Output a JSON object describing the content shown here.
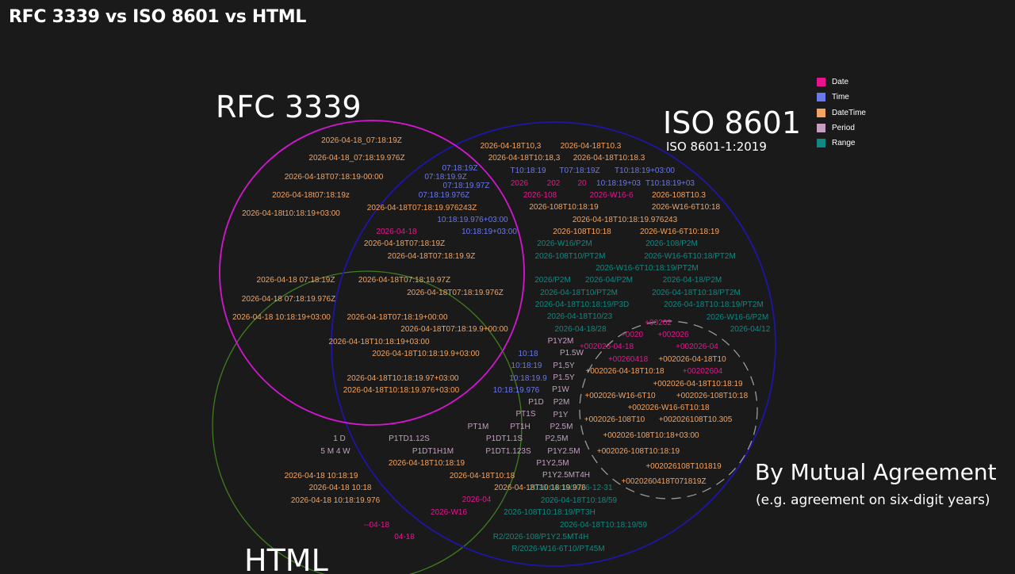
{
  "title": "RFC 3339 vs ISO 8601 vs HTML",
  "colors": {
    "background": "#1a1a1a",
    "Date": "#e6158f",
    "Time": "#6a78ee",
    "DateTime": "#f4a460",
    "Period": "#c49fc0",
    "Range": "#0e8a82",
    "rfc_circle": "#d416d2",
    "iso_circle": "#1f15a8",
    "html_circle": "#3f7d1e",
    "mutual_circle": "#9a9a9a"
  },
  "legend": [
    {
      "label": "Date",
      "key": "Date"
    },
    {
      "label": "Time",
      "key": "Time"
    },
    {
      "label": "DateTime",
      "key": "DateTime"
    },
    {
      "label": "Period",
      "key": "Period"
    },
    {
      "label": "Range",
      "key": "Range"
    }
  ],
  "sets": {
    "rfc": {
      "name": "RFC 3339"
    },
    "iso": {
      "name": "ISO 8601",
      "subtitle": "ISO 8601-1:2019"
    },
    "html": {
      "name": "HTML"
    },
    "mutual": {
      "name": "By Mutual Agreement",
      "subtitle": "(e.g. agreement on six-digit years)"
    }
  },
  "items": [
    {
      "text": "2026-04-18_07:18:19Z",
      "type": "DateTime",
      "region": "rfc"
    },
    {
      "text": "2026-04-18_07:18:19.976Z",
      "type": "DateTime",
      "region": "rfc"
    },
    {
      "text": "2026-04-18T07:18:19-00:00",
      "type": "DateTime",
      "region": "rfc"
    },
    {
      "text": "2026-04-18t07:18:19z",
      "type": "DateTime",
      "region": "rfc"
    },
    {
      "text": "2026-04-18t10:18:19+03:00",
      "type": "DateTime",
      "region": "rfc"
    },
    {
      "text": "07:18:19Z",
      "type": "Time",
      "region": "rfc+iso"
    },
    {
      "text": "07:18:19.9Z",
      "type": "Time",
      "region": "rfc+iso"
    },
    {
      "text": "07:18:19.97Z",
      "type": "Time",
      "region": "rfc+iso"
    },
    {
      "text": "07:18:19.976Z",
      "type": "Time",
      "region": "rfc+iso"
    },
    {
      "text": "2026-04-18T07:18:19.976243Z",
      "type": "DateTime",
      "region": "rfc+iso"
    },
    {
      "text": "10:18:19.976+03:00",
      "type": "Time",
      "region": "rfc+iso"
    },
    {
      "text": "10:18:19+03:00",
      "type": "Time",
      "region": "rfc+iso"
    },
    {
      "text": "2026-04-18",
      "type": "Date",
      "region": "all"
    },
    {
      "text": "2026-04-18T07:18:19Z",
      "type": "DateTime",
      "region": "all"
    },
    {
      "text": "2026-04-18T07:18:19.9Z",
      "type": "DateTime",
      "region": "all"
    },
    {
      "text": "2026-04-18T07:18:19.97Z",
      "type": "DateTime",
      "region": "all"
    },
    {
      "text": "2026-04-18T07:18:19.976Z",
      "type": "DateTime",
      "region": "all"
    },
    {
      "text": "2026-04-18T07:18:19+00:00",
      "type": "DateTime",
      "region": "all"
    },
    {
      "text": "2026-04-18T07:18:19.9+00:00",
      "type": "DateTime",
      "region": "all"
    },
    {
      "text": "2026-04-18T10:18:19+03:00",
      "type": "DateTime",
      "region": "all"
    },
    {
      "text": "2026-04-18T10:18:19.9+03:00",
      "type": "DateTime",
      "region": "all"
    },
    {
      "text": "2026-04-18T10:18:19.97+03:00",
      "type": "DateTime",
      "region": "all"
    },
    {
      "text": "2026-04-18T10:18:19.976+03:00",
      "type": "DateTime",
      "region": "all"
    },
    {
      "text": "2026-04-18 07:18:19Z",
      "type": "DateTime",
      "region": "rfc+html"
    },
    {
      "text": "2026-04-18 07:18:19.976Z",
      "type": "DateTime",
      "region": "rfc+html"
    },
    {
      "text": "2026-04-18 10:18:19+03:00",
      "type": "DateTime",
      "region": "rfc+html"
    },
    {
      "text": "2026-04-18T10,3",
      "type": "DateTime",
      "region": "iso"
    },
    {
      "text": "2026-04-18T10.3",
      "type": "DateTime",
      "region": "iso"
    },
    {
      "text": "2026-04-18T10:18,3",
      "type": "DateTime",
      "region": "iso"
    },
    {
      "text": "2026-04-18T10:18.3",
      "type": "DateTime",
      "region": "iso"
    },
    {
      "text": "T10:18:19",
      "type": "Time",
      "region": "iso"
    },
    {
      "text": "T07:18:19Z",
      "type": "Time",
      "region": "iso"
    },
    {
      "text": "T10:18:19+03:00",
      "type": "Time",
      "region": "iso"
    },
    {
      "text": "2026",
      "type": "Date",
      "region": "iso"
    },
    {
      "text": "202",
      "type": "Date",
      "region": "iso"
    },
    {
      "text": "20",
      "type": "Date",
      "region": "iso"
    },
    {
      "text": "10:18:19+03",
      "type": "Time",
      "region": "iso"
    },
    {
      "text": "T10:18:19+03",
      "type": "Time",
      "region": "iso"
    },
    {
      "text": "2026-108",
      "type": "Date",
      "region": "iso"
    },
    {
      "text": "2026-W16-6",
      "type": "Date",
      "region": "iso"
    },
    {
      "text": "2026-108T10.3",
      "type": "DateTime",
      "region": "iso"
    },
    {
      "text": "2026-108T10:18:19",
      "type": "DateTime",
      "region": "iso"
    },
    {
      "text": "2026-W16-6T10:18",
      "type": "DateTime",
      "region": "iso"
    },
    {
      "text": "2026-04-18T10:18:19.976243",
      "type": "DateTime",
      "region": "iso"
    },
    {
      "text": "2026-108T10:18",
      "type": "DateTime",
      "region": "iso"
    },
    {
      "text": "2026-W16-6T10:18:19",
      "type": "DateTime",
      "region": "iso"
    },
    {
      "text": "2026-W16/P2M",
      "type": "Range",
      "region": "iso"
    },
    {
      "text": "2026-108/P2M",
      "type": "Range",
      "region": "iso"
    },
    {
      "text": "2026-108T10/PT2M",
      "type": "Range",
      "region": "iso"
    },
    {
      "text": "2026-W16-6T10:18/PT2M",
      "type": "Range",
      "region": "iso"
    },
    {
      "text": "2026-W16-6T10:18:19/PT2M",
      "type": "Range",
      "region": "iso"
    },
    {
      "text": "2026/P2M",
      "type": "Range",
      "region": "iso"
    },
    {
      "text": "2026-04/P2M",
      "type": "Range",
      "region": "iso"
    },
    {
      "text": "2026-04-18/P2M",
      "type": "Range",
      "region": "iso"
    },
    {
      "text": "2026-04-18T10/PT2M",
      "type": "Range",
      "region": "iso"
    },
    {
      "text": "2026-04-18T10:18/PT2M",
      "type": "Range",
      "region": "iso"
    },
    {
      "text": "2026-04-18T10:18:19/P3D",
      "type": "Range",
      "region": "iso"
    },
    {
      "text": "2026-04-18T10:18:19/PT2M",
      "type": "Range",
      "region": "iso"
    },
    {
      "text": "2026-04-18T10/23",
      "type": "Range",
      "region": "iso"
    },
    {
      "text": "2026-W16-6/P2M",
      "type": "Range",
      "region": "iso"
    },
    {
      "text": "2026-04-18/28",
      "type": "Range",
      "region": "iso"
    },
    {
      "text": "2026-04/12",
      "type": "Range",
      "region": "iso"
    },
    {
      "text": "P1Y2M",
      "type": "Period",
      "region": "iso"
    },
    {
      "text": "P1.5W",
      "type": "Period",
      "region": "iso"
    },
    {
      "text": "P1,5Y",
      "type": "Period",
      "region": "iso"
    },
    {
      "text": "P1.5Y",
      "type": "Period",
      "region": "iso"
    },
    {
      "text": "P1W",
      "type": "Period",
      "region": "iso"
    },
    {
      "text": "P2M",
      "type": "Period",
      "region": "iso"
    },
    {
      "text": "P1Y",
      "type": "Period",
      "region": "iso"
    },
    {
      "text": "P2.5M",
      "type": "Period",
      "region": "iso"
    },
    {
      "text": "P2,5M",
      "type": "Period",
      "region": "iso"
    },
    {
      "text": "P1Y2.5M",
      "type": "Period",
      "region": "iso"
    },
    {
      "text": "P1Y2,5M",
      "type": "Period",
      "region": "iso"
    },
    {
      "text": "P1Y2.5MT4H",
      "type": "Period",
      "region": "iso"
    },
    {
      "text": "2026-04-18/2026-12-31",
      "type": "Range",
      "region": "iso"
    },
    {
      "text": "2026-04-18T10:18/59",
      "type": "Range",
      "region": "iso"
    },
    {
      "text": "2026-108T10:18:19/PT3H",
      "type": "Range",
      "region": "iso"
    },
    {
      "text": "2026-04-18T10:18:19/59",
      "type": "Range",
      "region": "iso"
    },
    {
      "text": "R2/2026-108/P1Y2.5MT4H",
      "type": "Range",
      "region": "iso"
    },
    {
      "text": "R/2026-W16-6T10/PT45M",
      "type": "Range",
      "region": "iso"
    },
    {
      "text": "10:18",
      "type": "Time",
      "region": "iso+html"
    },
    {
      "text": "10:18:19",
      "type": "Time",
      "region": "iso+html"
    },
    {
      "text": "10:18:19.9",
      "type": "Time",
      "region": "iso+html"
    },
    {
      "text": "10:18:19.976",
      "type": "Time",
      "region": "iso+html"
    },
    {
      "text": "P1D",
      "type": "Period",
      "region": "iso+html"
    },
    {
      "text": "PT1S",
      "type": "Period",
      "region": "iso+html"
    },
    {
      "text": "PT1M",
      "type": "Period",
      "region": "iso+html"
    },
    {
      "text": "PT1H",
      "type": "Period",
      "region": "iso+html"
    },
    {
      "text": "P1TD1.12S",
      "type": "Period",
      "region": "iso+html"
    },
    {
      "text": "P1DT1.1S",
      "type": "Period",
      "region": "iso+html"
    },
    {
      "text": "P1DT1H1M",
      "type": "Period",
      "region": "iso+html"
    },
    {
      "text": "P1DT1.123S",
      "type": "Period",
      "region": "iso+html"
    },
    {
      "text": "2026-04-18T10:18:19",
      "type": "DateTime",
      "region": "iso+html"
    },
    {
      "text": "2026-04-18T10:18",
      "type": "DateTime",
      "region": "iso+html"
    },
    {
      "text": "2026-04-18T10:18:19.976",
      "type": "DateTime",
      "region": "iso+html"
    },
    {
      "text": "2026-04",
      "type": "Date",
      "region": "iso+html"
    },
    {
      "text": "2026-W16",
      "type": "Date",
      "region": "iso+html"
    },
    {
      "text": "1 D",
      "type": "Period",
      "region": "html"
    },
    {
      "text": "5 M 4 W",
      "type": "Period",
      "region": "html"
    },
    {
      "text": "2026-04-18 10:18:19",
      "type": "DateTime",
      "region": "html"
    },
    {
      "text": "2026-04-18 10:18",
      "type": "DateTime",
      "region": "html"
    },
    {
      "text": "2026-04-18 10:18:19.976",
      "type": "DateTime",
      "region": "html"
    },
    {
      "text": "--04-18",
      "type": "Date",
      "region": "html"
    },
    {
      "text": "04-18",
      "type": "Date",
      "region": "html"
    },
    {
      "text": "+00202",
      "type": "Date",
      "region": "mutual"
    },
    {
      "text": "+0020",
      "type": "Date",
      "region": "mutual"
    },
    {
      "text": "+002026",
      "type": "Date",
      "region": "mutual"
    },
    {
      "text": "+002026-04-18",
      "type": "Date",
      "region": "mutual"
    },
    {
      "text": "+002026-04",
      "type": "Date",
      "region": "mutual"
    },
    {
      "text": "+00260418",
      "type": "Date",
      "region": "mutual"
    },
    {
      "text": "+002026-04-18T10",
      "type": "DateTime",
      "region": "mutual"
    },
    {
      "text": "+002026-04-18T10:18",
      "type": "DateTime",
      "region": "mutual"
    },
    {
      "text": "+00202604",
      "type": "Date",
      "region": "mutual"
    },
    {
      "text": "+002026-04-18T10:18:19",
      "type": "DateTime",
      "region": "mutual"
    },
    {
      "text": "+002026-W16-6T10",
      "type": "DateTime",
      "region": "mutual"
    },
    {
      "text": "+002026-108T10:18",
      "type": "DateTime",
      "region": "mutual"
    },
    {
      "text": "+002026-W16-6T10:18",
      "type": "DateTime",
      "region": "mutual"
    },
    {
      "text": "+002026-108T10",
      "type": "DateTime",
      "region": "mutual"
    },
    {
      "text": "+002026108T10.305",
      "type": "DateTime",
      "region": "mutual"
    },
    {
      "text": "+002026-108T10:18+03:00",
      "type": "DateTime",
      "region": "mutual"
    },
    {
      "text": "+002026-108T10:18:19",
      "type": "DateTime",
      "region": "mutual"
    },
    {
      "text": "+002026108T101819",
      "type": "DateTime",
      "region": "mutual"
    },
    {
      "text": "+0020260418T071819Z",
      "type": "DateTime",
      "region": "mutual"
    }
  ]
}
